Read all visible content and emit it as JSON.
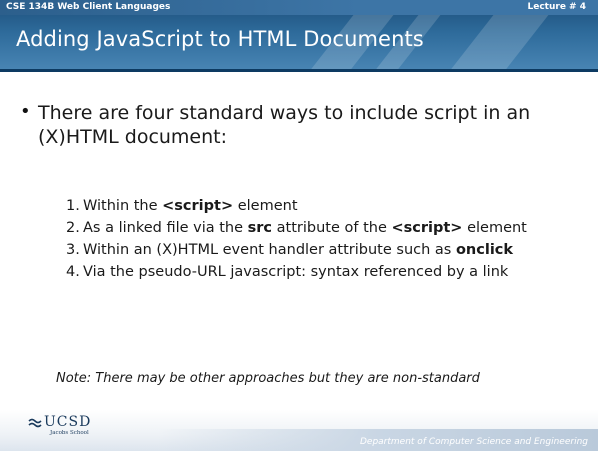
{
  "header": {
    "course": "CSE 134B  Web Client Languages",
    "lecture": "Lecture # 4",
    "title": "Adding JavaScript to HTML Documents"
  },
  "body": {
    "intro": "There are four standard ways to include script in an (X)HTML document:",
    "items": [
      {
        "number": "1.",
        "parts": [
          "Within the ",
          "<script>",
          " element"
        ]
      },
      {
        "number": "2.",
        "parts": [
          "As a linked file via the ",
          "src",
          " attribute of the ",
          "<script>",
          " element"
        ]
      },
      {
        "number": "3.",
        "parts": [
          "Within an (X)HTML event handler attribute such as ",
          "onclick"
        ]
      },
      {
        "number": "4.",
        "parts": [
          "Via the pseudo-URL javascript: syntax referenced by a link"
        ]
      }
    ],
    "note": "Note: There may be other approaches but they are non-standard"
  },
  "footer": {
    "logo_text": "UCSD",
    "logo_subtext": "Jacobs School",
    "department": "Department of Computer Science and Engineering"
  },
  "colors": {
    "header_blue": "#2e6b9b",
    "text": "#1a1a1a"
  }
}
